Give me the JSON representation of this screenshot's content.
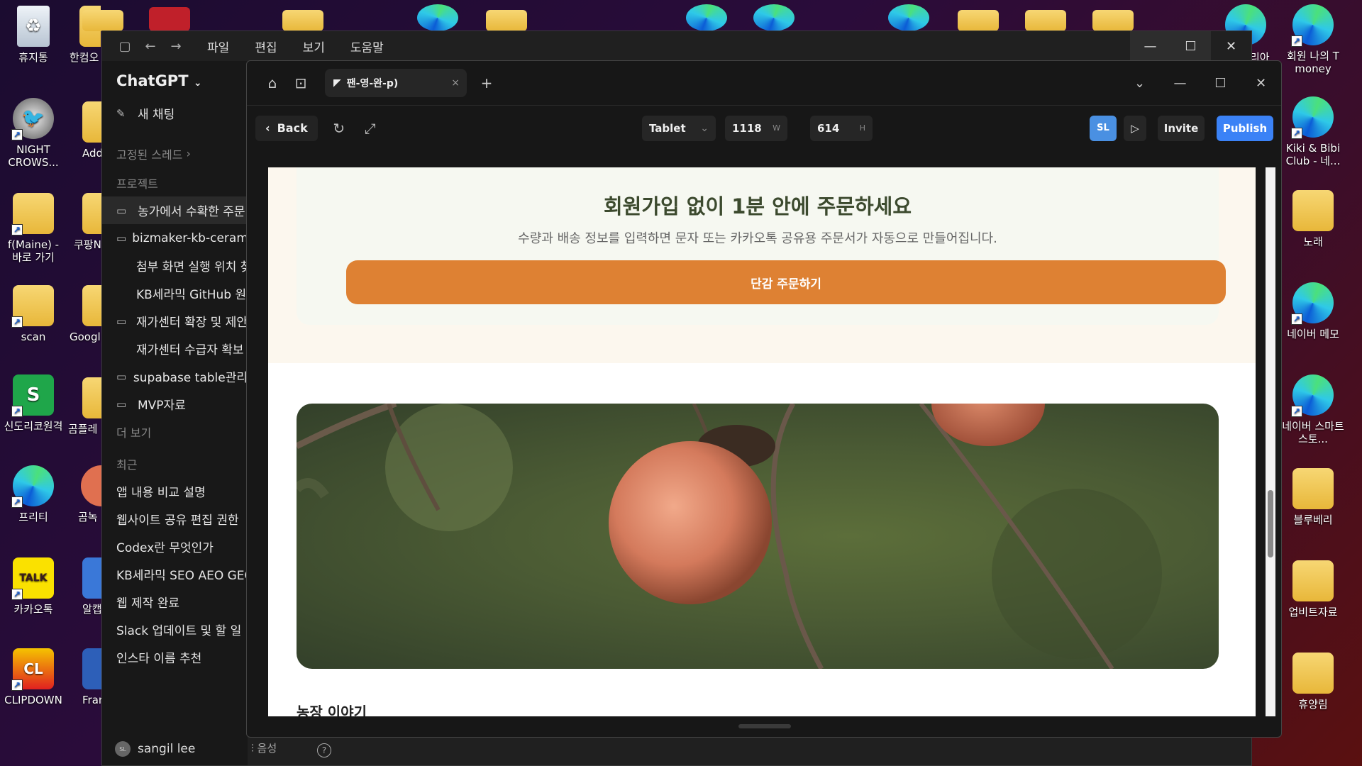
{
  "desktop": {
    "left_icons": [
      {
        "label": "휴지통",
        "icon": "recycle-bin-icon"
      },
      {
        "label": "NIGHT CROWS...",
        "icon": "night-crows-icon"
      },
      {
        "label": "f(Maine) - 바로 가기",
        "icon": "folder-icon"
      },
      {
        "label": "scan",
        "icon": "folder-icon"
      },
      {
        "label": "신도리코원격",
        "icon": "sindoh-remote-icon"
      },
      {
        "label": "프리티",
        "icon": "edge-icon"
      },
      {
        "label": "카카오톡",
        "icon": "kakaotalk-icon"
      },
      {
        "label": "CLIPDOWN",
        "icon": "clipdown-icon"
      }
    ],
    "second_col_icons": [
      {
        "label": "한컴오"
      },
      {
        "label": "Add"
      },
      {
        "label": "쿠팡N"
      },
      {
        "label": "Googl"
      },
      {
        "label": "곰플레"
      },
      {
        "label": "곰녹"
      },
      {
        "label": "알캡"
      },
      {
        "label": "Fran"
      }
    ],
    "right_icons": [
      {
        "label": "회원 나의 T money",
        "icon": "edge-icon"
      },
      {
        "label": "Kiki & Bibi Club - 네...",
        "icon": "edge-icon"
      },
      {
        "label": "노래",
        "icon": "folder-icon"
      },
      {
        "label": "네이버 메모",
        "icon": "edge-icon"
      },
      {
        "label": "네이버 스마트스토...",
        "icon": "edge-icon"
      },
      {
        "label": "블루베리",
        "icon": "folder-icon"
      },
      {
        "label": "업비트자료",
        "icon": "folder-icon"
      },
      {
        "label": "휴양림",
        "icon": "folder-icon"
      }
    ],
    "partial_label": "리아",
    "talk_text": "TALK",
    "sindoh_letter": "S",
    "clip_text": "CL"
  },
  "chatgpt": {
    "menu": [
      "파일",
      "편집",
      "보기",
      "도움말"
    ],
    "brand": "ChatGPT",
    "new_chat": "새 채팅",
    "pinned": "고정된 스레드",
    "projects_label": "프로젝트",
    "projects": [
      {
        "label": "농가에서 수확한 주문",
        "type": "folder",
        "active": true
      },
      {
        "label": "bizmaker-kb-ceramic",
        "type": "folder"
      },
      {
        "label": "첨부 화면 실행 위치 찾",
        "type": "sub"
      },
      {
        "label": "KB세라믹 GitHub 원본",
        "type": "sub"
      },
      {
        "label": "재가센터 확장 및 제안",
        "type": "folder"
      },
      {
        "label": "재가센터 수급자 확보",
        "type": "sub"
      },
      {
        "label": "supabase table관리",
        "type": "folder"
      },
      {
        "label": "MVP자료",
        "type": "folder"
      }
    ],
    "more": "더 보기",
    "recent_label": "최근",
    "recent": [
      "앱 내용 비교 설명",
      "웹사이트 공유 편집 권한",
      "Codex란 무엇인가",
      "KB세라믹 SEO AEO GEO",
      "웹 제작 완료",
      "Slack 업데이트 및 할 일",
      "인스타 이름 추천"
    ],
    "user_initials": "SL",
    "user_name": "sangil lee",
    "voice_label": "음성",
    "help": "?"
  },
  "builder": {
    "tab_title": "팬-영-완-p)",
    "back_label": "Back",
    "device": "Tablet",
    "width_value": "1118",
    "width_unit": "W",
    "height_value": "614",
    "height_unit": "H",
    "avatar_initials": "SL",
    "invite_label": "Invite",
    "publish_label": "Publish",
    "colors": {
      "publish": "#3b82f6",
      "avatar": "#4a90e2",
      "cta": "#de8133"
    }
  },
  "preview": {
    "hero_title": "회원가입 없이 1분 안에 주문하세요",
    "hero_subtitle": "수량과 배송 정보를 입력하면 문자 또는 카카오톡 공유용 주문서가 자동으로 만들어집니다.",
    "cta_label": "단감 주문하기",
    "image_alt": "persimmons-on-branch-photo",
    "story_heading": "농장 이야기"
  }
}
